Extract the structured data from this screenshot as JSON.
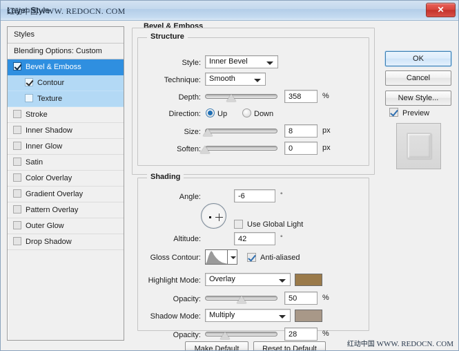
{
  "window": {
    "title": "Layer Style",
    "watermark": "WWW. REDOCN. COM",
    "watermark_cn": "红动中国",
    "close_label": "✕"
  },
  "styles_panel": {
    "header": "Styles",
    "blending_options": "Blending Options: Custom",
    "items": [
      {
        "label": "Bevel & Emboss",
        "checked": true,
        "selected": true,
        "sub": false
      },
      {
        "label": "Contour",
        "checked": true,
        "selected": false,
        "sub": true
      },
      {
        "label": "Texture",
        "checked": false,
        "selected": false,
        "sub": true
      },
      {
        "label": "Stroke",
        "checked": false,
        "selected": false,
        "sub": false
      },
      {
        "label": "Inner Shadow",
        "checked": false,
        "selected": false,
        "sub": false
      },
      {
        "label": "Inner Glow",
        "checked": false,
        "selected": false,
        "sub": false
      },
      {
        "label": "Satin",
        "checked": false,
        "selected": false,
        "sub": false
      },
      {
        "label": "Color Overlay",
        "checked": false,
        "selected": false,
        "sub": false
      },
      {
        "label": "Gradient Overlay",
        "checked": false,
        "selected": false,
        "sub": false
      },
      {
        "label": "Pattern Overlay",
        "checked": false,
        "selected": false,
        "sub": false
      },
      {
        "label": "Outer Glow",
        "checked": false,
        "selected": false,
        "sub": false
      },
      {
        "label": "Drop Shadow",
        "checked": false,
        "selected": false,
        "sub": false
      }
    ]
  },
  "main": {
    "panel_title": "Bevel & Emboss",
    "structure": {
      "legend": "Structure",
      "style_label": "Style:",
      "style_value": "Inner Bevel",
      "technique_label": "Technique:",
      "technique_value": "Smooth",
      "depth_label": "Depth:",
      "depth_value": "358",
      "depth_unit": "%",
      "depth_pct": 36,
      "direction_label": "Direction:",
      "direction_up": "Up",
      "direction_down": "Down",
      "direction_selected": "Up",
      "size_label": "Size:",
      "size_value": "8",
      "size_unit": "px",
      "size_pct": 4,
      "soften_label": "Soften:",
      "soften_value": "0",
      "soften_unit": "px",
      "soften_pct": 0
    },
    "shading": {
      "legend": "Shading",
      "angle_label": "Angle:",
      "angle_value": "-6",
      "angle_unit": "°",
      "use_global_light": "Use Global Light",
      "use_global_light_checked": false,
      "altitude_label": "Altitude:",
      "altitude_value": "42",
      "altitude_unit": "°",
      "gloss_contour_label": "Gloss Contour:",
      "anti_aliased": "Anti-aliased",
      "anti_aliased_checked": true,
      "highlight_mode_label": "Highlight Mode:",
      "highlight_mode_value": "Overlay",
      "highlight_color": "#9a7a4a",
      "highlight_opacity_label": "Opacity:",
      "highlight_opacity_value": "50",
      "highlight_opacity_unit": "%",
      "highlight_opacity_pct": 50,
      "shadow_mode_label": "Shadow Mode:",
      "shadow_mode_value": "Multiply",
      "shadow_color": "#a89888",
      "shadow_opacity_label": "Opacity:",
      "shadow_opacity_value": "28",
      "shadow_opacity_unit": "%",
      "shadow_opacity_pct": 28
    }
  },
  "buttons": {
    "ok": "OK",
    "cancel": "Cancel",
    "new_style": "New Style...",
    "preview": "Preview",
    "preview_checked": true,
    "make_default": "Make Default",
    "reset_to_default": "Reset to Default"
  }
}
